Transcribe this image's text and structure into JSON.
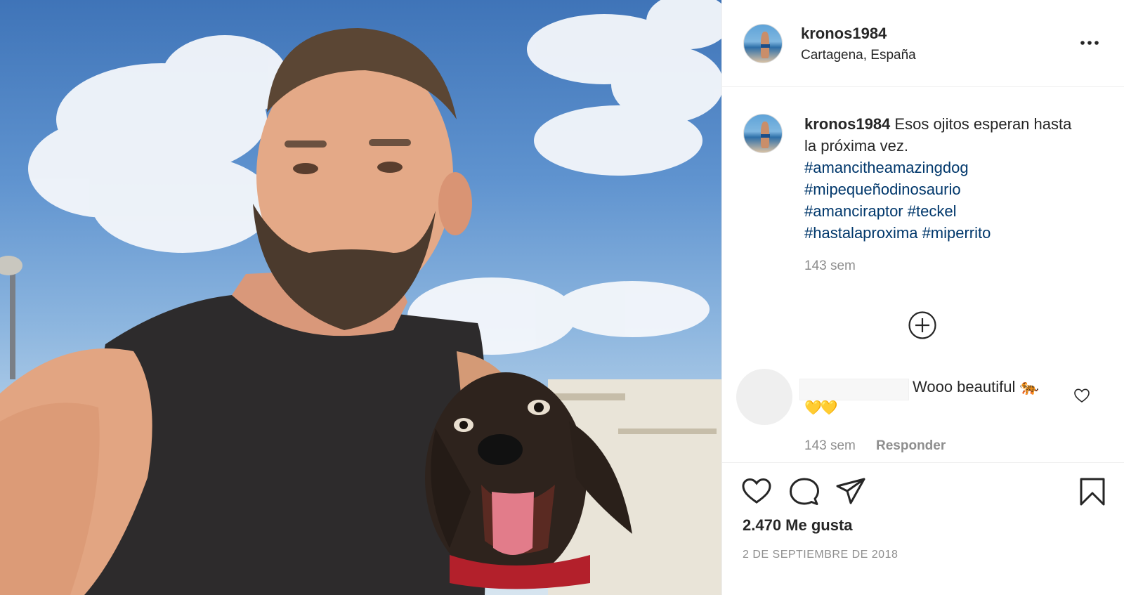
{
  "post": {
    "username": "kronos1984",
    "location": "Cartagena, España",
    "caption": {
      "username": "kronos1984",
      "text": "Esos ojitos esperan hasta la próxima vez.",
      "hashtags": [
        "#amancitheamazingdog",
        "#mipequeñodinosaurio",
        "#amanciraptor",
        "#teckel",
        "#hastalaproxima",
        "#miperrito"
      ],
      "time": "143 sem"
    },
    "comments": [
      {
        "text": "Wooo beautiful 🐅",
        "emoji_line": "💛💛",
        "time": "143 sem",
        "reply_label": "Responder"
      }
    ],
    "likes_text": "2.470 Me gusta",
    "date_text": "2 DE SEPTIEMBRE DE 2018"
  },
  "icons": {
    "more": "more-options-icon",
    "load_more": "plus-circle-icon",
    "like": "heart-icon",
    "comment": "comment-bubble-icon",
    "share": "paper-plane-icon",
    "save": "bookmark-icon"
  },
  "colors": {
    "text": "#262626",
    "secondary": "#8e8e8e",
    "hashtag": "#00376b",
    "border": "#efefef"
  }
}
